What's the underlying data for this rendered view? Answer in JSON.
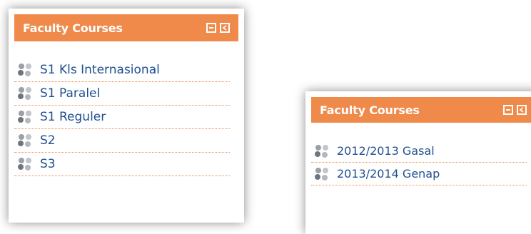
{
  "colors": {
    "header": "#f08a4b",
    "link": "#1f4f8f",
    "separator": "#f08a4b"
  },
  "left_block": {
    "title": "Faculty Courses",
    "items": [
      {
        "label": "S1 Kls Internasional",
        "icon": "course-category-icon"
      },
      {
        "label": "S1 Paralel",
        "icon": "course-category-icon"
      },
      {
        "label": "S1 Reguler",
        "icon": "course-category-icon"
      },
      {
        "label": "S2",
        "icon": "course-category-icon"
      },
      {
        "label": "S3",
        "icon": "course-category-icon"
      }
    ]
  },
  "right_block": {
    "title": "Faculty Courses",
    "items": [
      {
        "label": "2012/2013 Gasal",
        "icon": "course-category-icon"
      },
      {
        "label": "2013/2014 Genap",
        "icon": "course-category-icon"
      }
    ]
  }
}
